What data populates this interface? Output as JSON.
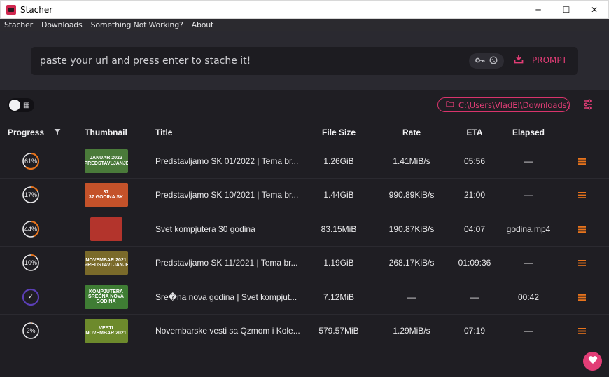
{
  "window": {
    "title": "Stacher",
    "minimize": "─",
    "maximize": "☐",
    "close": "✕"
  },
  "menu": [
    "Stacher",
    "Downloads",
    "Something Not Working?",
    "About"
  ],
  "url_bar": {
    "placeholder": "paste your url and press enter to stache it!",
    "value": "",
    "prompt_label": "PROMPT"
  },
  "toolbar": {
    "download_path": "C:\\Users\\VladEl\\Downloads\\"
  },
  "table": {
    "headers": {
      "progress": "Progress",
      "thumbnail": "Thumbnail",
      "title": "Title",
      "size": "File Size",
      "rate": "Rate",
      "eta": "ETA",
      "elapsed": "Elapsed"
    },
    "rows": [
      {
        "progress_label": "61%",
        "progress": 0.61,
        "ring_color": "#e8741c",
        "title": "Predstavljamo SK 01/2022 | Tema br...",
        "size": "1.26GiB",
        "rate": "1.41MiB/s",
        "eta": "05:56",
        "elapsed": "—",
        "thumb_text": [
          "JANUAR 2022",
          "PREDSTAVLJANJE"
        ],
        "thumb_bg": "#4a7a3a"
      },
      {
        "progress_label": "17%",
        "progress": 0.17,
        "ring_color": "#e8741c",
        "title": "Predstavljamo SK 10/2021 | Tema br...",
        "size": "1.44GiB",
        "rate": "990.89KiB/s",
        "eta": "21:00",
        "elapsed": "—",
        "thumb_text": [
          "37",
          "37 GODINA SK"
        ],
        "thumb_bg": "#c4522a"
      },
      {
        "progress_label": "44%",
        "progress": 0.44,
        "ring_color": "#e8741c",
        "title": "Svet kompjutera 30 godina",
        "size": "83.15MiB",
        "rate": "190.87KiB/s",
        "eta": "04:07",
        "elapsed": "godina.mp4",
        "thumb_text": [
          "",
          ""
        ],
        "thumb_bg": "#b3342c"
      },
      {
        "progress_label": "10%",
        "progress": 0.1,
        "ring_color": "#e8741c",
        "title": "Predstavljamo SK 11/2021 | Tema br...",
        "size": "1.19GiB",
        "rate": "268.17KiB/s",
        "eta": "01:09:36",
        "elapsed": "—",
        "thumb_text": [
          "NOVEMBAR 2021",
          "PREDSTAVLJANJE"
        ],
        "thumb_bg": "#7a6a2a"
      },
      {
        "progress_label": "✓",
        "progress": 1.0,
        "ring_color": "#5b3fb6",
        "title": "Sre�na nova godina | Svet kompjut...",
        "size": "7.12MiB",
        "rate": "—",
        "eta": "—",
        "elapsed": "00:42",
        "thumb_text": [
          "KOMPJUTERA",
          "SREĆNA NOVA GODINA"
        ],
        "thumb_bg": "#3f7d34"
      },
      {
        "progress_label": "2%",
        "progress": 0.02,
        "ring_color": "#e8741c",
        "title": "Novembarske vesti sa Qzmom i Kole...",
        "size": "579.57MiB",
        "rate": "1.29MiB/s",
        "eta": "07:19",
        "elapsed": "—",
        "thumb_text": [
          "VESTI",
          "NOVEMBAR 2021"
        ],
        "thumb_bg": "#6d8a2c"
      }
    ]
  },
  "colors": {
    "accent": "#e23d76",
    "progress": "#e8741c",
    "complete": "#5b3fb6",
    "menu_icon": "#e8741c"
  },
  "icons": {
    "key": "key-icon",
    "cookie": "cookie-icon",
    "download": "download-icon",
    "folder": "folder-icon",
    "sliders": "sliders-icon",
    "filter": "filter-icon",
    "row_menu": "hamburger-icon",
    "heart": "heart-icon"
  }
}
